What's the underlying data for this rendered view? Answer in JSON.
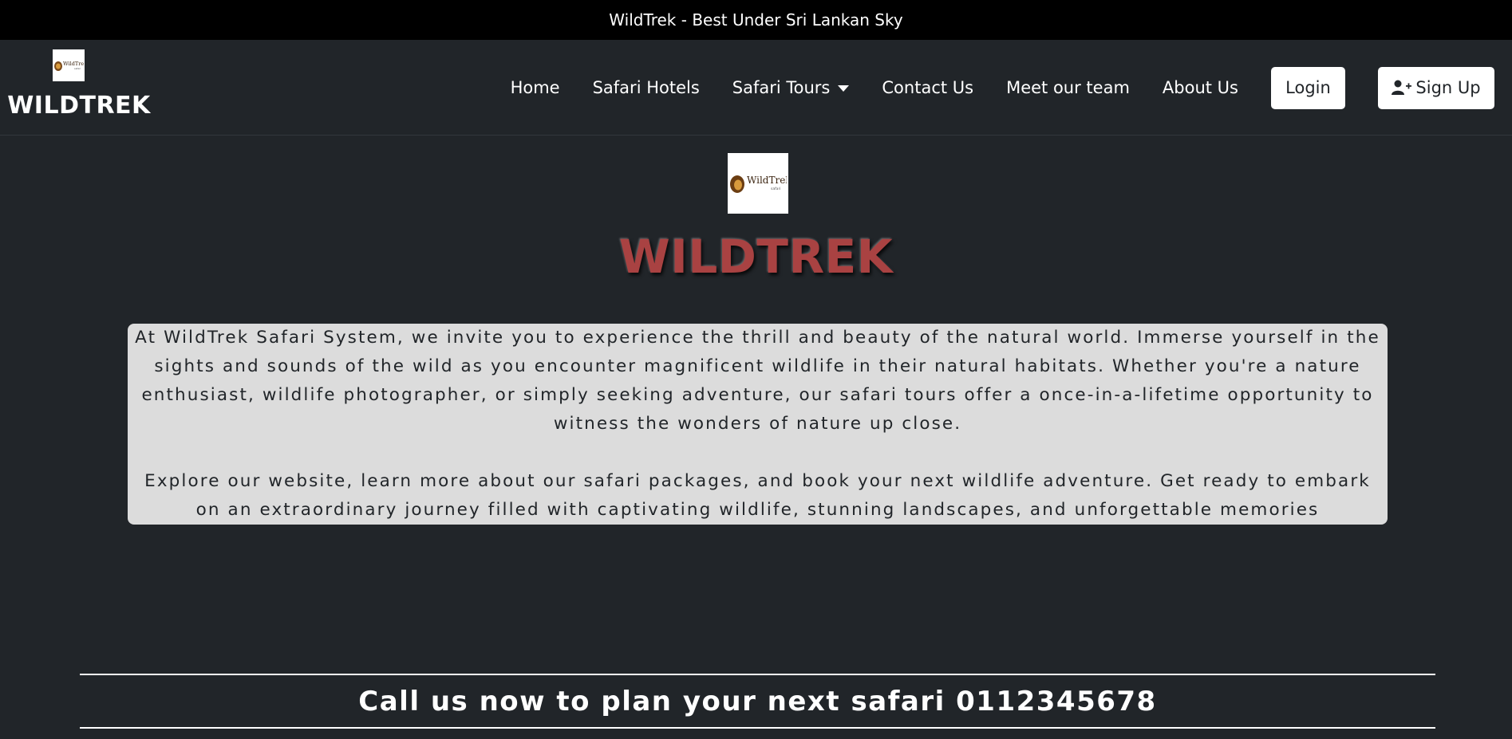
{
  "topbar": {
    "text": "WildTrek - Best Under Sri Lankan Sky"
  },
  "brand": {
    "name": "WILDTREK",
    "logo_text": "WildTrek"
  },
  "nav": {
    "items": [
      {
        "label": "Home"
      },
      {
        "label": "Safari Hotels"
      },
      {
        "label": "Safari Tours"
      },
      {
        "label": "Contact Us"
      },
      {
        "label": "Meet our team"
      },
      {
        "label": "About Us"
      }
    ],
    "login_label": "Login",
    "signup_label": "Sign Up"
  },
  "hero": {
    "logo_text": "WildTrek",
    "title": "WILDTREK",
    "paragraph1": "At WildTrek Safari System, we invite you to experience the thrill and beauty of the natural world. Immerse yourself in the sights and sounds of the wild as you encounter magnificent wildlife in their natural habitats. Whether you're a nature enthusiast, wildlife photographer, or simply seeking adventure, our safari tours offer a once-in-a-lifetime opportunity to witness the wonders of nature up close.",
    "paragraph2": "Explore our website, learn more about our safari packages, and book your next wildlife adventure. Get ready to embark on an extraordinary journey filled with captivating wildlife, stunning landscapes, and unforgettable memories"
  },
  "callus": {
    "text": "Call us now to plan your next safari 0112345678"
  },
  "colors": {
    "background": "#212529",
    "topbar": "#000000",
    "title_red": "#a94242",
    "intro_box": "#dcdcdc"
  },
  "icons": {
    "logo": "lion-logo-icon",
    "signup": "user-plus-icon",
    "dropdown": "caret-down-icon"
  }
}
